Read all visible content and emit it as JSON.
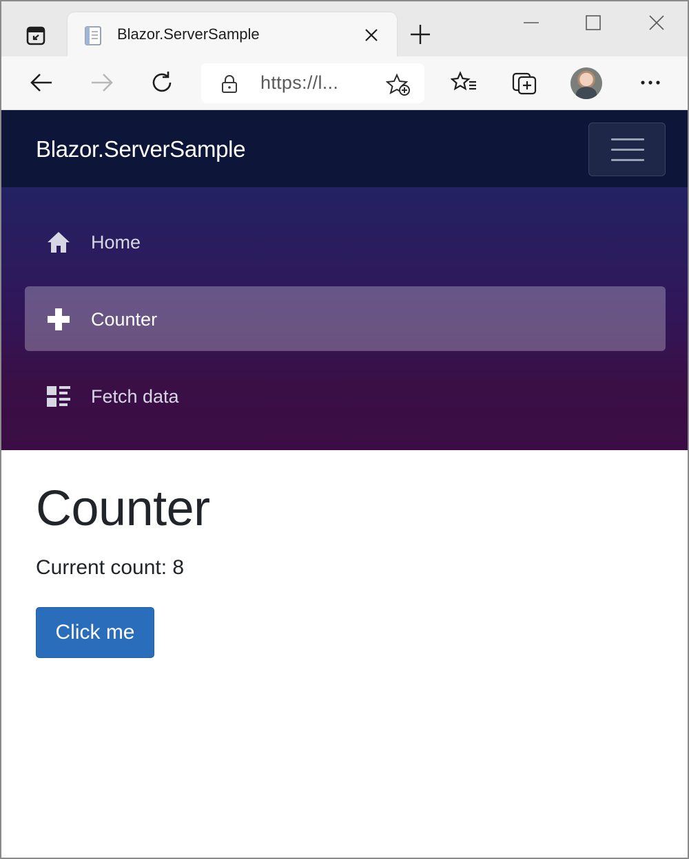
{
  "browser": {
    "tab": {
      "title": "Blazor.ServerSample"
    },
    "address": {
      "url": "https://l..."
    }
  },
  "app": {
    "brand": "Blazor.ServerSample",
    "nav": [
      {
        "label": "Home",
        "icon": "home-icon",
        "active": false
      },
      {
        "label": "Counter",
        "icon": "plus-icon",
        "active": true
      },
      {
        "label": "Fetch data",
        "icon": "list-rich-icon",
        "active": false
      }
    ]
  },
  "page": {
    "title": "Counter",
    "count_text": "Current count: 8",
    "button_label": "Click me"
  },
  "colors": {
    "header_bg": "#0d1539",
    "nav_gradient_top": "#232262",
    "nav_gradient_bottom": "#3b0d44",
    "primary_button": "#2a6ebb"
  }
}
